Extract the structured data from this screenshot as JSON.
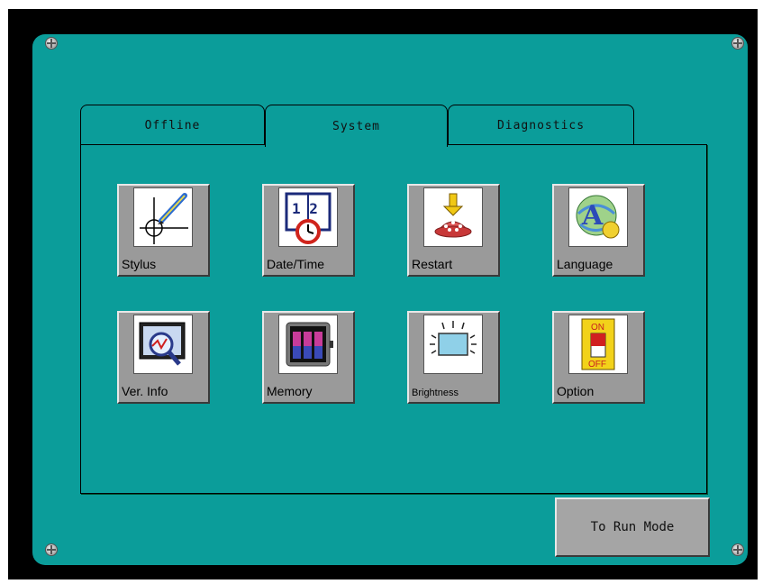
{
  "tabs": [
    {
      "label": "Offline"
    },
    {
      "label": "System"
    },
    {
      "label": "Diagnostics"
    }
  ],
  "active_tab": "System",
  "buttons": [
    {
      "label": "Stylus",
      "icon": "stylus-icon"
    },
    {
      "label": "Date/Time",
      "icon": "calendar-clock-icon"
    },
    {
      "label": "Restart",
      "icon": "restart-icon"
    },
    {
      "label": "Language",
      "icon": "language-icon"
    },
    {
      "label": "Ver. Info",
      "icon": "version-info-icon"
    },
    {
      "label": "Memory",
      "icon": "memory-icon"
    },
    {
      "label": "Brightness",
      "icon": "brightness-icon"
    },
    {
      "label": "Option",
      "icon": "on-off-switch-icon"
    }
  ],
  "icon_text": {
    "date_top": "1 2",
    "switch_on": "ON",
    "switch_off": "OFF"
  },
  "run_button": {
    "label": "To Run Mode"
  },
  "colors": {
    "panel": "#0b9d9a",
    "button": "#9a9a9a",
    "bezel": "#000000"
  }
}
